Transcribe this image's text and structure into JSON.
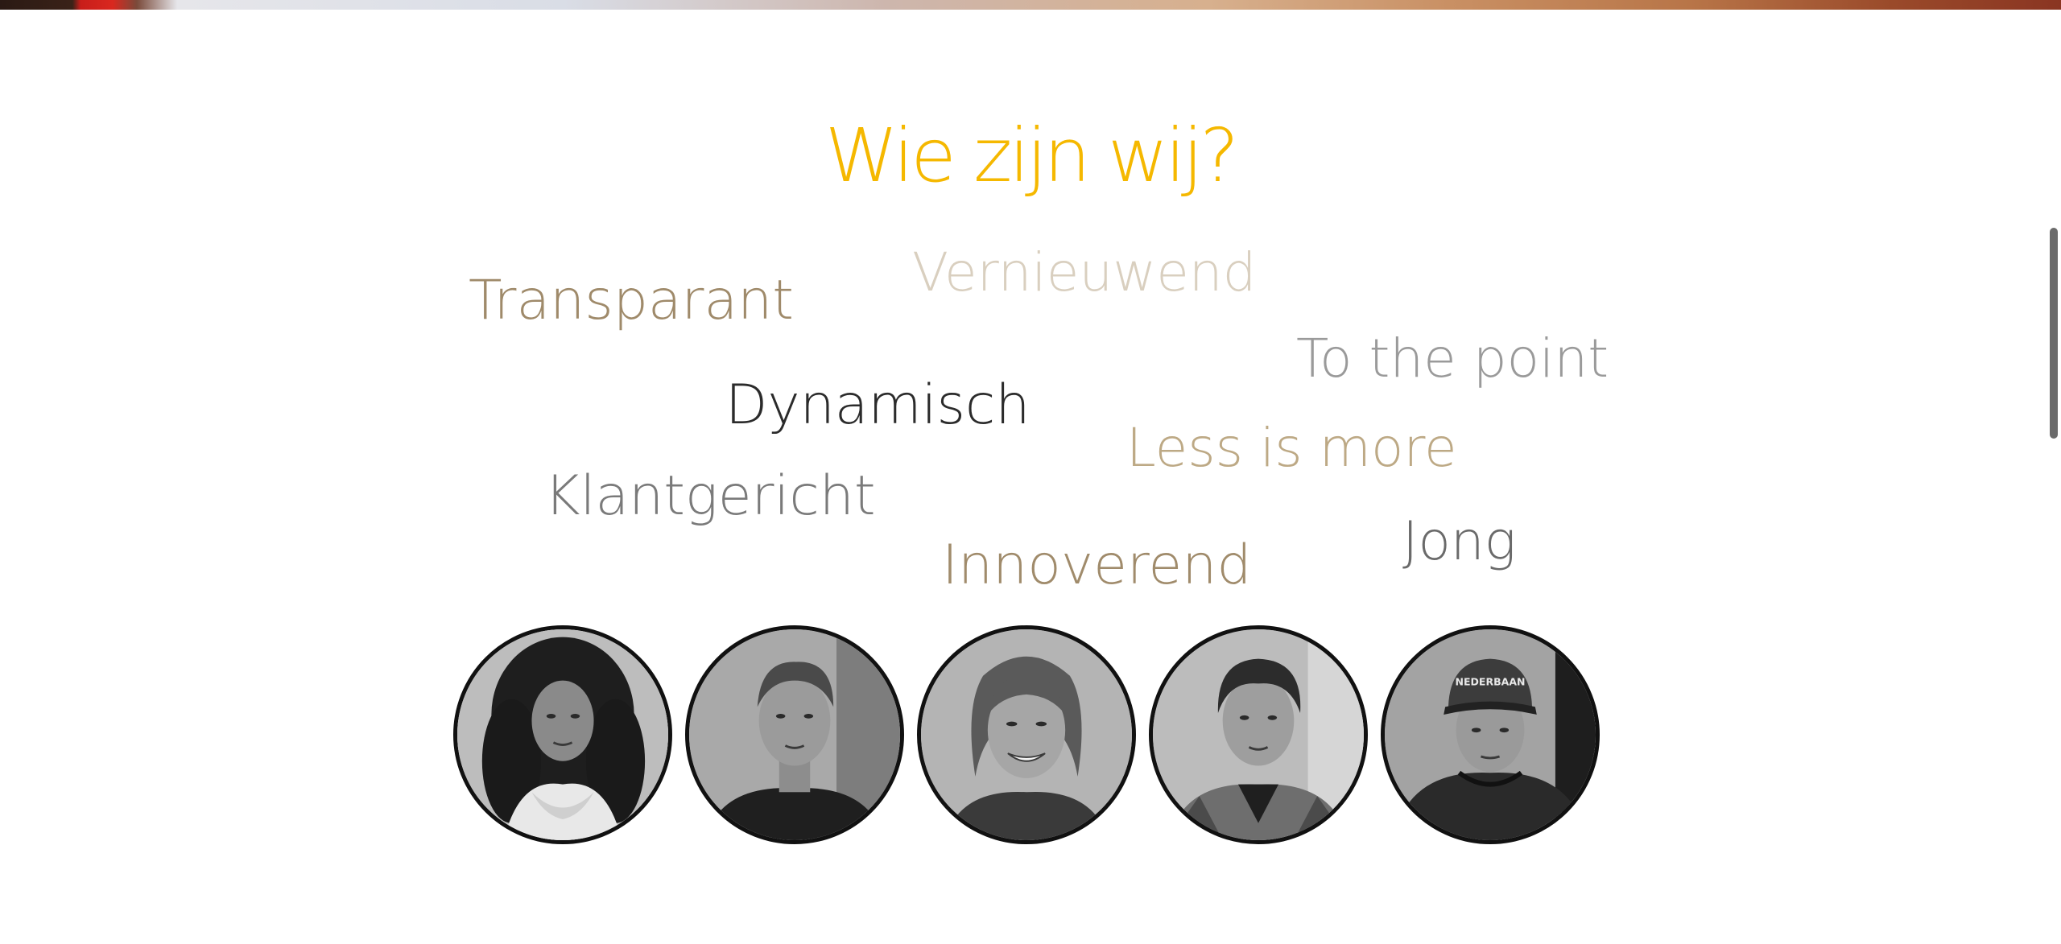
{
  "section": {
    "title": "Wie zijn wij?",
    "title_color": "#f5b800"
  },
  "words": {
    "transparant": "Transparant",
    "vernieuwend": "Vernieuwend",
    "to_the_point": "To the point",
    "dynamisch": "Dynamisch",
    "less_is_more": "Less is more",
    "klantgericht": "Klantgericht",
    "jong": "Jong",
    "innoverend": "Innoverend"
  },
  "team": {
    "members": [
      {
        "icon": "team-member-photo-1"
      },
      {
        "icon": "team-member-photo-2"
      },
      {
        "icon": "team-member-photo-3"
      },
      {
        "icon": "team-member-photo-4"
      },
      {
        "icon": "team-member-photo-5",
        "cap_text": "NEDERBAAN"
      }
    ]
  },
  "scrollbar": {
    "thumb_color": "#6b6b6b"
  }
}
